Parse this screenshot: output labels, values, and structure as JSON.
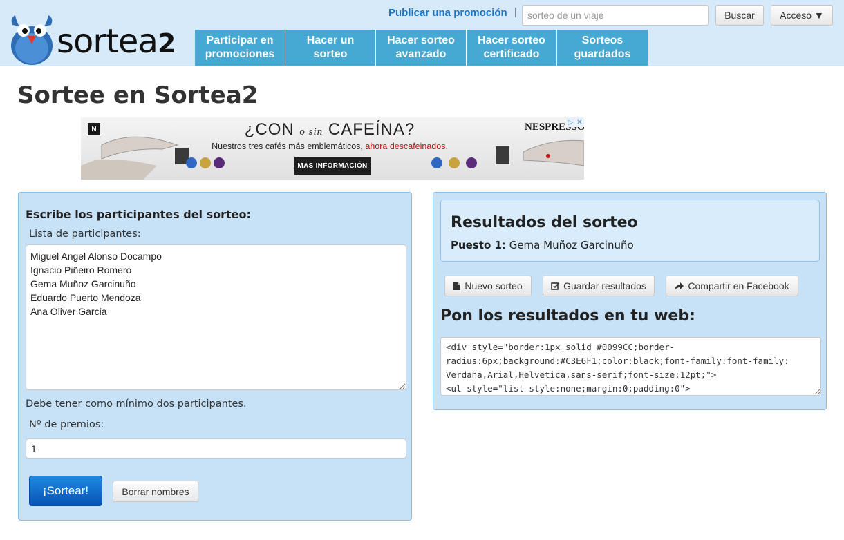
{
  "header": {
    "logo_text": "sortea",
    "logo_suffix": "2",
    "publish_link": "Publicar una promoción",
    "separator": "|",
    "search_placeholder": "sorteo de un viaje",
    "search_button": "Buscar",
    "access_button": "Acceso ▼",
    "nav": [
      {
        "label": "Participar en promociones"
      },
      {
        "label": "Hacer un sorteo"
      },
      {
        "label": "Hacer sorteo avanzado"
      },
      {
        "label": "Hacer sorteo certificado"
      },
      {
        "label": "Sorteos guardados"
      }
    ]
  },
  "page_title": "Sortee en Sortea2",
  "ad": {
    "badge": "N",
    "headline_a": "¿CON",
    "headline_b": "o sin",
    "headline_c": "CAFEÍNA?",
    "sub_a": "Nuestros tres cafés más emblemáticos,",
    "sub_b": "ahora descafeinados.",
    "cta": "MÁS INFORMACIÓN",
    "brand": "NESPRESSO.",
    "close_a": "▷",
    "close_b": "✕"
  },
  "left_panel": {
    "heading": "Escribe los participantes del sorteo:",
    "list_label": "Lista de participantes:",
    "participants": "Miguel Angel Alonso Docampo\nIgnacio Piñeiro Romero\nGema Muñoz Garcinuño\nEduardo Puerto Mendoza\nAna Oliver Garcia",
    "hint": "Debe tener como mínimo dos participantes.",
    "prizes_label": "Nº de premios:",
    "prizes_value": "1",
    "draw_button": "¡Sortear!",
    "clear_button": "Borrar nombres"
  },
  "right_panel": {
    "results_title": "Resultados del sorteo",
    "position_label": "Puesto 1:",
    "position_winner": "Gema Muñoz Garcinuño",
    "new_button": "Nuevo sorteo",
    "save_button": "Guardar resultados",
    "share_button": "Compartir en Facebook",
    "web_title": "Pon los resultados en tu web:",
    "embed_code": "<div style=\"border:1px solid #0099CC;border-radius:6px;background:#C3E6F1;color:black;font-family:font-family: Verdana,Arial,Helvetica,sans-serif;font-size:12pt;\">\n<ul style=\"list-style:none;margin:0;padding:0\">"
  },
  "colors": {
    "header_bg": "#d6eaf9",
    "nav_bg": "#45a9d3",
    "panel_bg": "#c7e2f7",
    "primary_button": "#0953b5",
    "link": "#1a73c4"
  }
}
